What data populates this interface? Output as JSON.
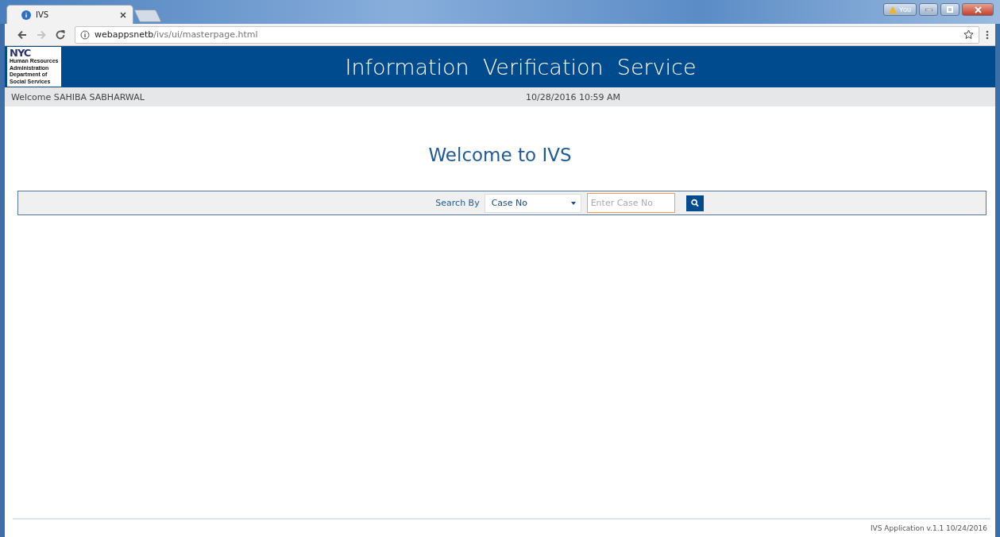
{
  "browser": {
    "tabs": [
      {
        "title": "IVS",
        "selected": true
      }
    ],
    "profile_label": "You",
    "nav_buttons": [
      {
        "kind": "back",
        "disabled": false
      },
      {
        "kind": "forward",
        "disabled": true
      },
      {
        "kind": "reload",
        "disabled": false
      }
    ],
    "address": {
      "host": "webappsnetb",
      "path": "/ivs/ui/masterpage.html"
    }
  },
  "header": {
    "logo": {
      "mark": "NYC",
      "lines": [
        "Human Resources",
        "Administration",
        "Department of",
        "Social Services"
      ]
    },
    "title": "Information  Verification  Service"
  },
  "user_bar": {
    "welcome": "Welcome SAHIBA SABHARWAL",
    "datetime": "10/28/2016 10:59 AM"
  },
  "heading": "Welcome to IVS",
  "search": {
    "label": "Search By",
    "select_value": "Case No",
    "placeholder": "Enter Case No"
  },
  "footer": {
    "text": "IVS Application v.1.1 10/24/2016"
  }
}
